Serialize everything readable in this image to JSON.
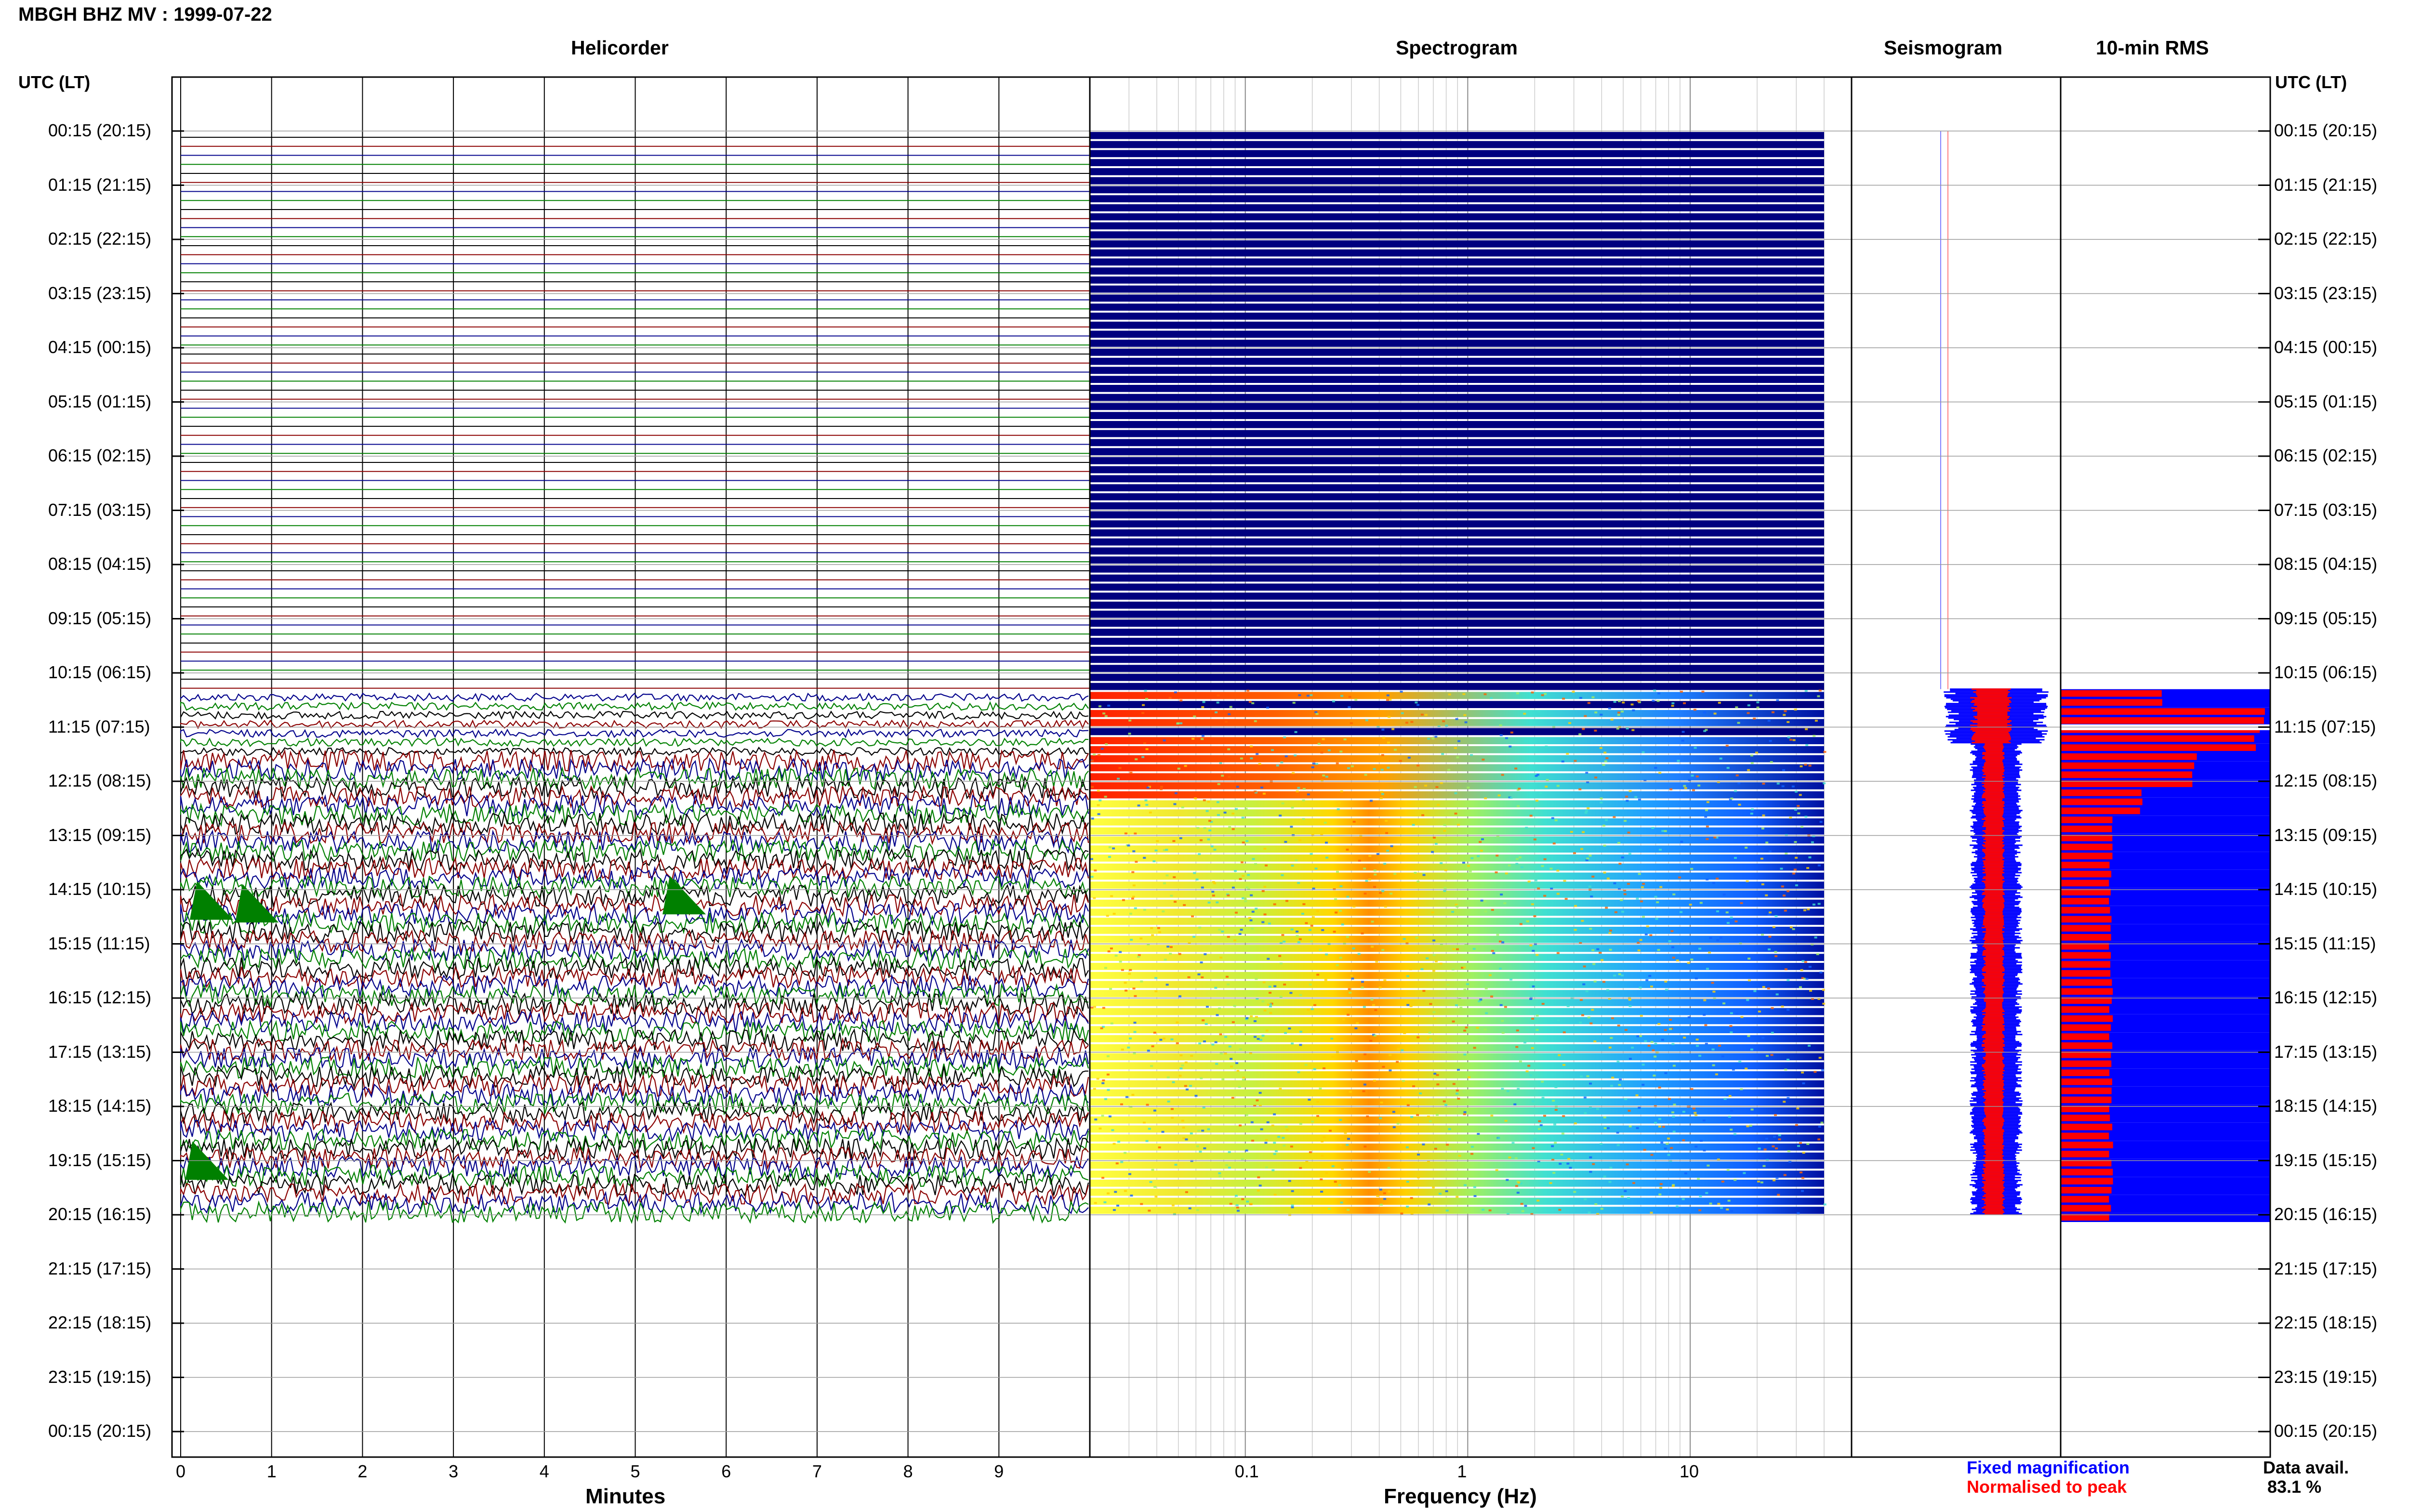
{
  "title": "MBGH BHZ MV : 1999-07-22",
  "utc_label": "UTC (LT)",
  "panels": {
    "helicorder": "Helicorder",
    "spectrogram": "Spectrogram",
    "seismogram": "Seismogram",
    "rms": "10-min RMS"
  },
  "xaxis": {
    "minutes_label": "Minutes",
    "frequency_label": "Frequency (Hz)"
  },
  "legend": {
    "fixed": "Fixed magnification",
    "normalised": "Normalised to peak",
    "fixed_color": "#0000ff",
    "normalised_color": "#ff0000"
  },
  "availability": {
    "label": "Data avail.",
    "value": "83.1 %"
  },
  "chart_data": {
    "type": "heatmap",
    "time_labels": [
      "00:15 (20:15)",
      "01:15 (21:15)",
      "02:15 (22:15)",
      "03:15 (23:15)",
      "04:15 (00:15)",
      "05:15 (01:15)",
      "06:15 (02:15)",
      "07:15 (03:15)",
      "08:15 (04:15)",
      "09:15 (05:15)",
      "10:15 (06:15)",
      "11:15 (07:15)",
      "12:15 (08:15)",
      "13:15 (09:15)",
      "14:15 (10:15)",
      "15:15 (11:15)",
      "16:15 (12:15)",
      "17:15 (13:15)",
      "18:15 (14:15)",
      "19:15 (15:15)",
      "20:15 (16:15)",
      "21:15 (17:15)",
      "22:15 (18:15)",
      "23:15 (19:15)",
      "00:15 (20:15)"
    ],
    "minute_ticks": [
      "0",
      "1",
      "2",
      "3",
      "4",
      "5",
      "6",
      "7",
      "8",
      "9"
    ],
    "frequency_ticks": [
      "0.1",
      "1",
      "10"
    ],
    "frequency_range_hz": [
      0.02,
      40
    ],
    "frequency_scale": "log",
    "data_start_row": 10.3,
    "data_end_row": 20,
    "trace_colors": [
      "#000000",
      "#8b0000",
      "#00008b",
      "#008000"
    ],
    "spectrogram_colors": {
      "no_data": "#00007f",
      "low": "#0050ff",
      "mid": "#40e0d0",
      "high": "#ffff00",
      "peak": "#ff4000"
    },
    "rms_values_note": "normalised bar lengths per 10-min",
    "rms_profile": [
      {
        "from": 10.3,
        "to": 10.5,
        "red": 0.52,
        "blue": 1.0
      },
      {
        "from": 10.5,
        "to": 11.0,
        "red": 1.0,
        "blue": 1.0
      },
      {
        "from": 11.0,
        "to": 11.4,
        "red": 0.95,
        "blue": 1.0
      },
      {
        "from": 11.4,
        "to": 12.0,
        "red": 0.65,
        "blue": 1.0
      },
      {
        "from": 12.0,
        "to": 12.6,
        "red": 0.4,
        "blue": 1.0
      },
      {
        "from": 12.6,
        "to": 20.0,
        "red": 0.25,
        "blue": 1.0
      }
    ]
  }
}
